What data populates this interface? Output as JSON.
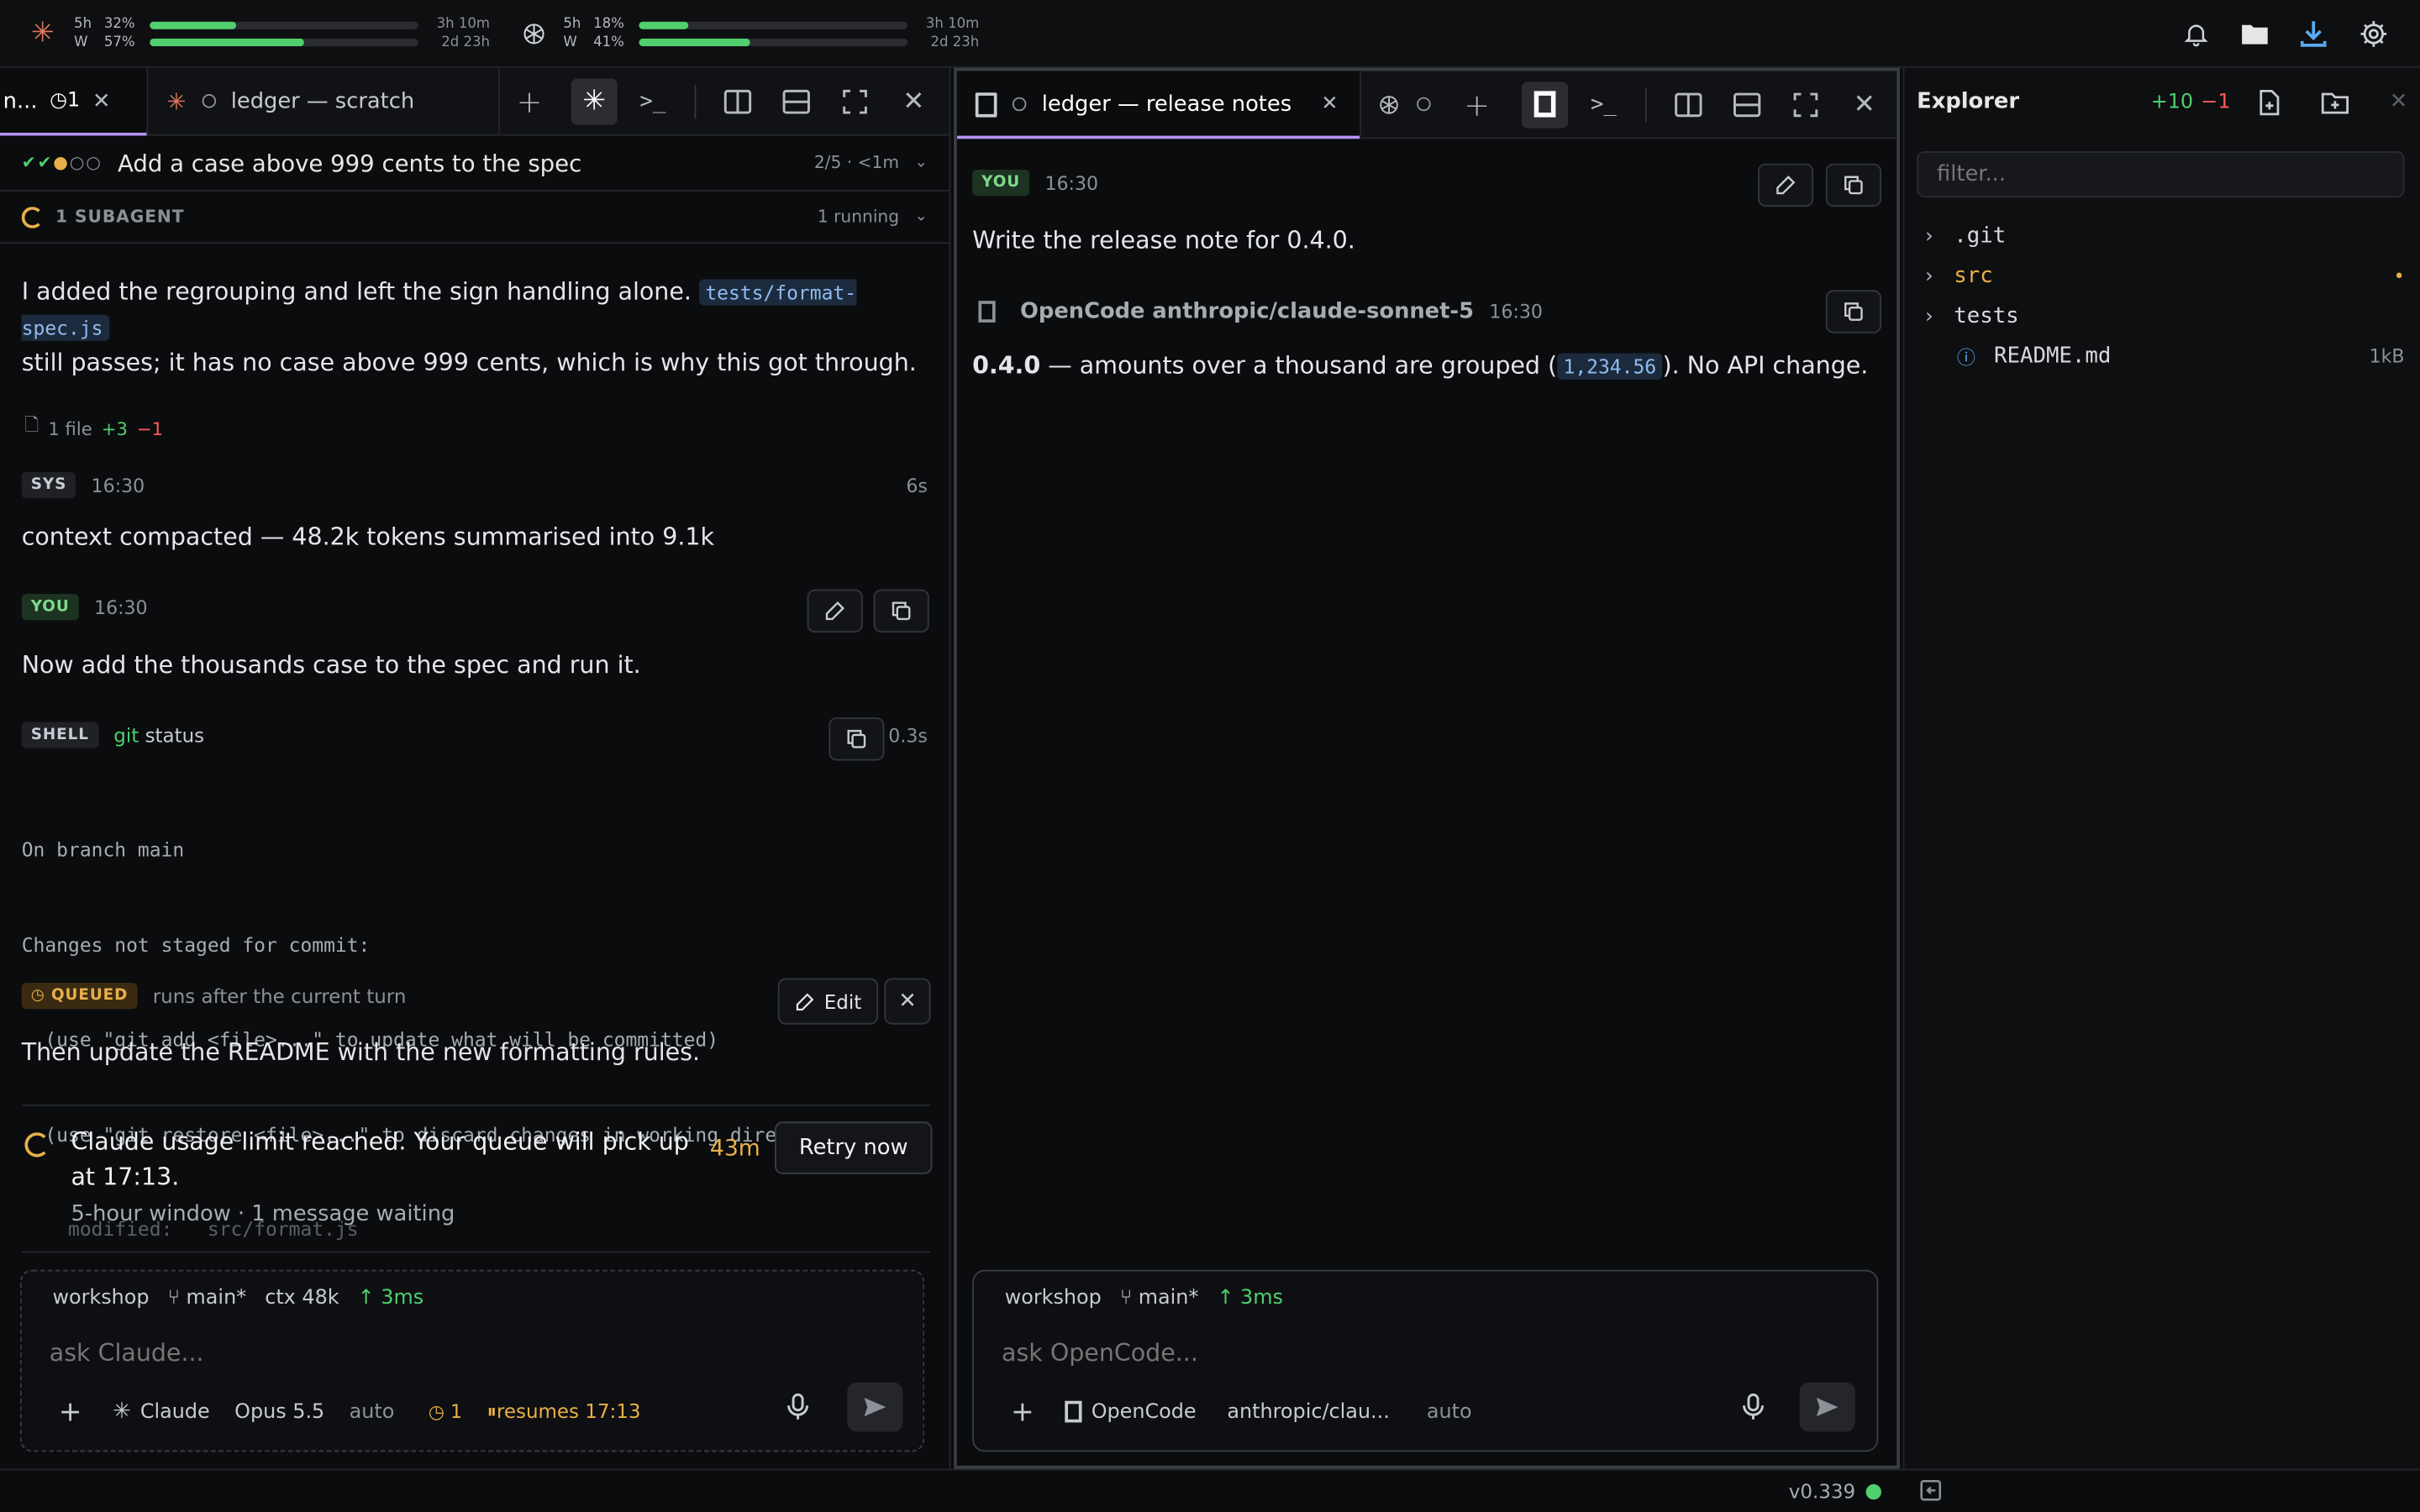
{
  "usage": [
    {
      "icon": "claude-icon",
      "period_top": "5h",
      "period_bottom": "W",
      "pct_top": "32%",
      "pct_bottom": "57%",
      "fill_top": 0.32,
      "fill_bottom": 0.57,
      "reset_top": "3h 10m",
      "reset_bottom": "2d 23h"
    },
    {
      "icon": "openai-icon",
      "period_top": "5h",
      "period_bottom": "W",
      "pct_top": "18%",
      "pct_bottom": "41%",
      "fill_top": 0.18,
      "fill_bottom": 0.41,
      "reset_top": "3h 10m",
      "reset_bottom": "2d 23h"
    }
  ],
  "left": {
    "tab1_label": "n...",
    "tab1_badge": "◷1",
    "tab2_label": "ledger — scratch",
    "task_title": "Add a case above 999 cents to the spec",
    "task_progress": "2/5 · <1m",
    "subagent_label": "1 SUBAGENT",
    "subagent_status": "1 running",
    "msg1_text": "I added the regrouping and left the sign handling alone.",
    "msg1_code": "tests/format-spec.js",
    "msg1_text2": "still passes; it has no case above 999 cents, which is why this got through.",
    "files_label": "1 file",
    "files_add": "+3",
    "files_del": "−1",
    "sys_chip": "SYS",
    "sys_time": "16:30",
    "sys_dur": "6s",
    "sys_text": "context compacted — 48.2k tokens summarised into 9.1k",
    "you_chip": "YOU",
    "you_time": "16:30",
    "you_text": "Now add the thousands case to the spec and run it.",
    "shell_chip": "SHELL",
    "shell_cmd": "git",
    "shell_args": "status",
    "shell_dur": "0.3s",
    "shell_out": [
      "On branch main",
      "Changes not staged for commit:",
      "  (use \"git add <file>...\" to update what will be committed)",
      "  (use \"git restore <file>...\" to discard changes in working directory)",
      "    modified:   src/format.js"
    ],
    "queued_chip": "QUEUED",
    "queued_note": "runs after the current turn",
    "edit_label": "Edit",
    "queued_text": "Then update the README with the new formatting rules.",
    "limit_title": "Claude usage limit reached. Your queue will pick up at 17:13.",
    "limit_sub": "5-hour window · 1 message waiting",
    "limit_eta": "43m",
    "retry_label": "Retry now",
    "composer": {
      "workspace": "workshop",
      "branch": "⑂ main*",
      "ctx": "ctx 48k",
      "latency": "↑ 3ms",
      "placeholder": "ask Claude...",
      "agent": "Claude",
      "model": "Opus 5.5",
      "mode": "auto",
      "queue_count": "◷ 1",
      "resumes": "resumes 17:13"
    }
  },
  "middle": {
    "tab_label": "ledger — release notes",
    "you_chip": "YOU",
    "you_time": "16:30",
    "you_text": "Write the release note for 0.4.0.",
    "agent_name": "OpenCode anthropic/claude-sonnet-5",
    "agent_time": "16:30",
    "reply_version": "0.4.0",
    "reply_text1": "— amounts over a thousand are grouped (",
    "reply_code": "1,234.56",
    "reply_text2": "). No API change.",
    "composer": {
      "workspace": "workshop",
      "branch": "⑂ main*",
      "latency": "↑ 3ms",
      "placeholder": "ask OpenCode...",
      "agent": "OpenCode",
      "model": "anthropic/clau...",
      "mode": "auto"
    }
  },
  "explorer": {
    "title": "Explorer",
    "added": "+10",
    "removed": "−1",
    "filter_placeholder": "filter...",
    "items": [
      {
        "name": ".git",
        "type": "folder",
        "color": "#d7d9dd",
        "mark": ""
      },
      {
        "name": "src",
        "type": "folder",
        "color": "#e8b04a",
        "mark": "•"
      },
      {
        "name": "tests",
        "type": "folder",
        "color": "#d7d9dd",
        "mark": ""
      },
      {
        "name": "README.md",
        "type": "file",
        "color": "#d7d9dd",
        "mark": "1kB"
      }
    ]
  },
  "status": {
    "version": "v0.339"
  },
  "colors": {
    "accent": "#b794f6",
    "green": "#4fcf6e",
    "orange": "#e8b04a",
    "red": "#ff5a5a",
    "code_bg": "#1c2a3d"
  }
}
